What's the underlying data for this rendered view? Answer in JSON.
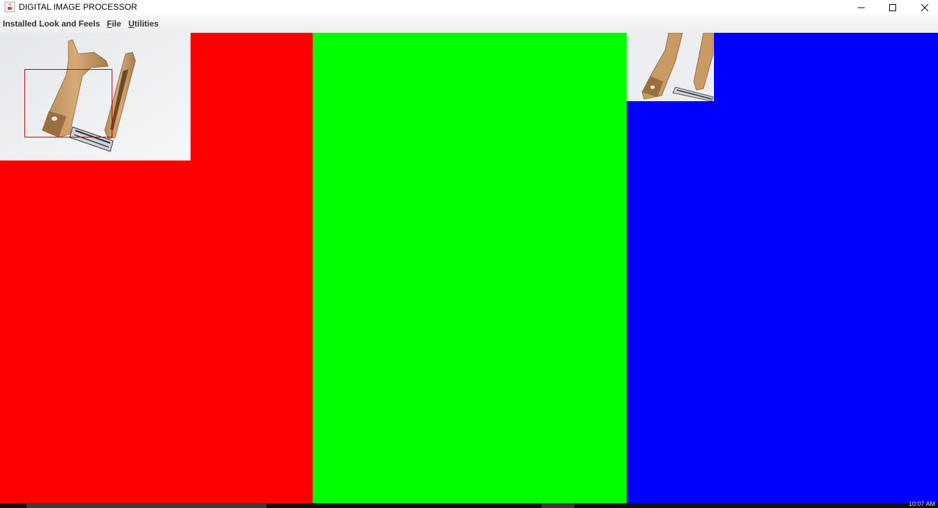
{
  "window": {
    "title": "DIGITAL IMAGE PROCESSOR",
    "icon": "java-cup-icon",
    "controls": [
      "minimize-icon",
      "maximize-icon",
      "close-icon"
    ]
  },
  "menubar": {
    "items": [
      {
        "label": "Installed Look and Feels"
      },
      {
        "mnemonic": "F",
        "rest": "ile"
      },
      {
        "mnemonic": "U",
        "rest": "tilities"
      }
    ]
  },
  "panels": {
    "red": "#ff0000",
    "green": "#00ff00",
    "blue": "#0000ff"
  },
  "images": {
    "main": "photo-cardboard-razor",
    "crop": "photo-cardboard-razor-crop",
    "selection_color": "#c00000"
  },
  "taskbar": {
    "clock": "10:07 AM"
  }
}
